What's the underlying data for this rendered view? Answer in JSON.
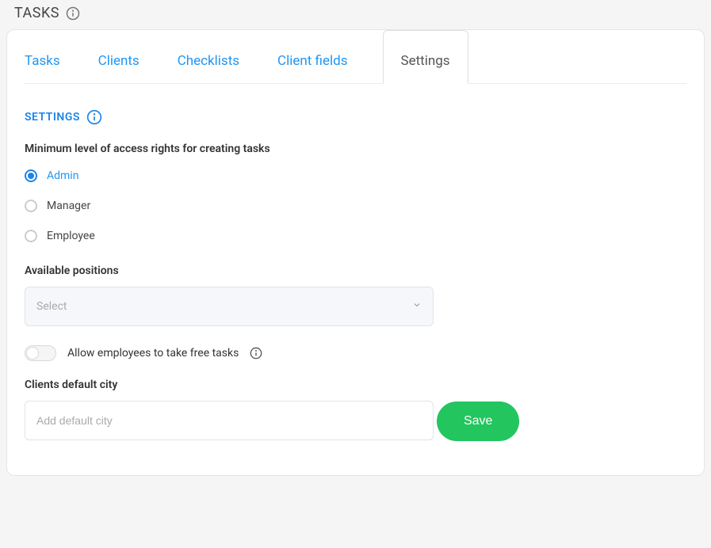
{
  "header": {
    "title": "TASKS"
  },
  "tabs": [
    {
      "label": "Tasks"
    },
    {
      "label": "Clients"
    },
    {
      "label": "Checklists"
    },
    {
      "label": "Client fields"
    },
    {
      "label": "Settings",
      "active": true
    }
  ],
  "section": {
    "title": "SETTINGS"
  },
  "accessRights": {
    "label": "Minimum level of access rights for creating tasks",
    "options": [
      {
        "label": "Admin",
        "selected": true
      },
      {
        "label": "Manager",
        "selected": false
      },
      {
        "label": "Employee",
        "selected": false
      }
    ]
  },
  "positions": {
    "label": "Available positions",
    "placeholder": "Select"
  },
  "allowFreeTasks": {
    "label": "Allow employees to take free tasks",
    "value": false
  },
  "defaultCity": {
    "label": "Clients default city",
    "placeholder": "Add default city",
    "value": ""
  },
  "save": {
    "label": "Save"
  }
}
